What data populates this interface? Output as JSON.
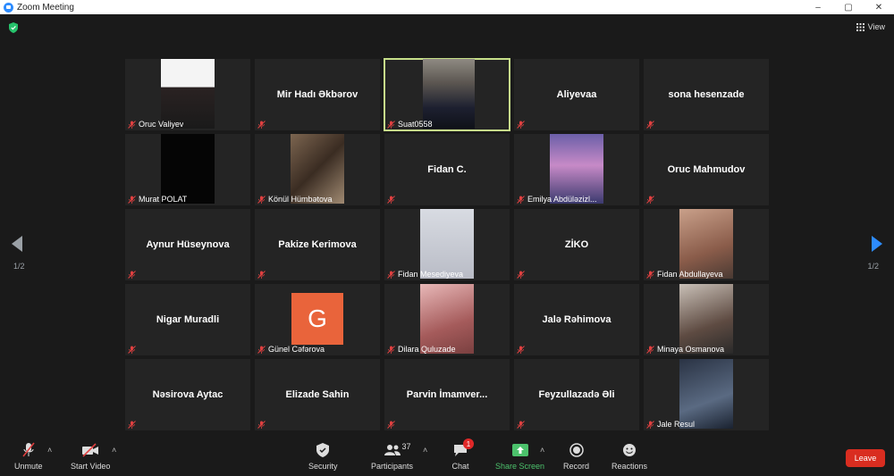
{
  "window": {
    "title": "Zoom Meeting",
    "controls": [
      "–",
      "▢",
      "✕"
    ]
  },
  "topbar": {
    "view_label": "View"
  },
  "participants": [
    {
      "name": "Oruc Valiyev",
      "video": "photo1"
    },
    {
      "name": "Mir Hadı Əkbərov",
      "video": null
    },
    {
      "name": "Suat0558",
      "video": "suat",
      "active_speaker": true
    },
    {
      "name": "Aliyevaa",
      "video": null
    },
    {
      "name": "sona hesenzade",
      "video": null
    },
    {
      "name": "Murat POLAT",
      "video": "black"
    },
    {
      "name": "Könül Hümbətova",
      "video": "stairs"
    },
    {
      "name": "Fidan C.",
      "video": null
    },
    {
      "name": "Emilya Abdüləzizl...",
      "video": "sky"
    },
    {
      "name": "Oruc Mahmudov",
      "video": null
    },
    {
      "name": "Aynur Hüseynova",
      "video": null
    },
    {
      "name": "Pakize Kerimova",
      "video": null
    },
    {
      "name": "Fidan Mesediyeva",
      "video": "snow"
    },
    {
      "name": "ZİKO",
      "video": null
    },
    {
      "name": "Fidan Abdullayeva",
      "video": "blond"
    },
    {
      "name": "Nigar Muradli",
      "video": null
    },
    {
      "name": "Günel Cəfərova",
      "video": "avatar",
      "avatar_letter": "G"
    },
    {
      "name": "Dilara Quluzade",
      "video": "girl"
    },
    {
      "name": "Jalə Rəhimova",
      "video": null
    },
    {
      "name": "Minaya Osmanova",
      "video": "cap"
    },
    {
      "name": "Nəsirova Aytac",
      "video": null
    },
    {
      "name": "Elizade Sahin",
      "video": null
    },
    {
      "name": "Parvin İmamver...",
      "video": null
    },
    {
      "name": "Feyzullazadə Əli",
      "video": null
    },
    {
      "name": "Jale Resul",
      "video": "selfie"
    }
  ],
  "pagination": {
    "left": "1/2",
    "right": "1/2"
  },
  "toolbar": {
    "unmute": "Unmute",
    "start_video": "Start Video",
    "security": "Security",
    "participants": "Participants",
    "participants_count": "37",
    "chat": "Chat",
    "chat_badge": "1",
    "share_screen": "Share Screen",
    "record": "Record",
    "reactions": "Reactions",
    "leave": "Leave"
  },
  "colors": {
    "active_border": "#c7e08a",
    "share_green": "#4cc26c",
    "leave_red": "#d92d20",
    "muted_red": "#e04040",
    "accent_blue": "#2d8cff"
  }
}
